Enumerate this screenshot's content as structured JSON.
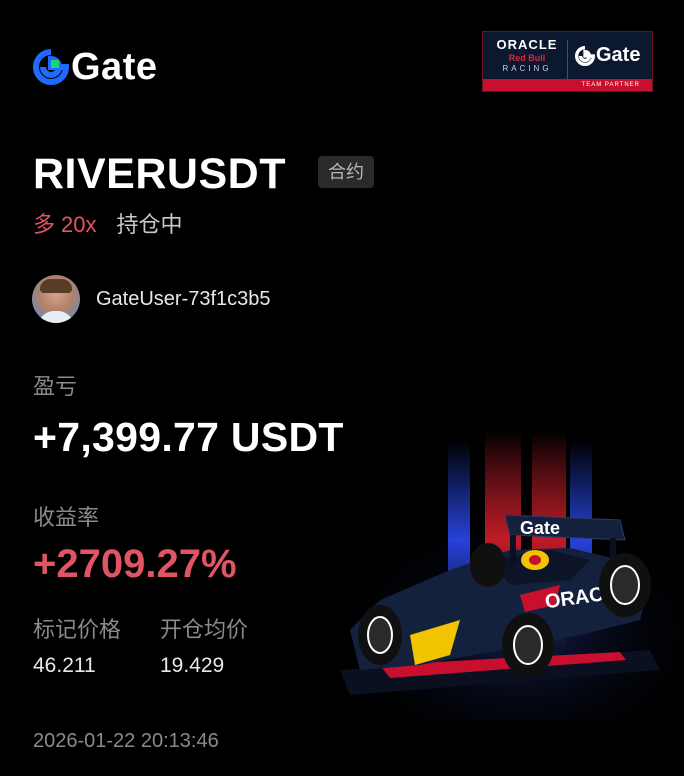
{
  "brand": {
    "logo_text": "Gate"
  },
  "partner_badge": {
    "oracle": "ORACLE",
    "redbull": "Red Bull",
    "racing": "RACING",
    "gate": "Gate",
    "strip": "TEAM PARTNER"
  },
  "position": {
    "symbol": "RIVERUSDT",
    "type_tag": "合约",
    "direction": "多",
    "leverage": "20x",
    "status": "持仓中"
  },
  "user": {
    "name": "GateUser-73f1c3b5"
  },
  "pnl": {
    "label": "盈亏",
    "value": "+7,399.77 USDT"
  },
  "roi": {
    "label": "收益率",
    "value": "+2709.27%"
  },
  "prices": {
    "mark_label": "标记价格",
    "mark_value": "46.211",
    "entry_label": "开仓均价",
    "entry_value": "19.429"
  },
  "timestamp": "2026-01-22 20:13:46",
  "car_livery": {
    "car_text": "ORACLE",
    "wing_text": "Gate"
  },
  "colors": {
    "background": "#000000",
    "profit_red": "#e05563",
    "muted_text": "#8a8a8a",
    "brand_blue": "#1f6bff",
    "brand_green": "#1ed27a",
    "car_navy": "#14213d",
    "accent_red": "#c8102e"
  }
}
